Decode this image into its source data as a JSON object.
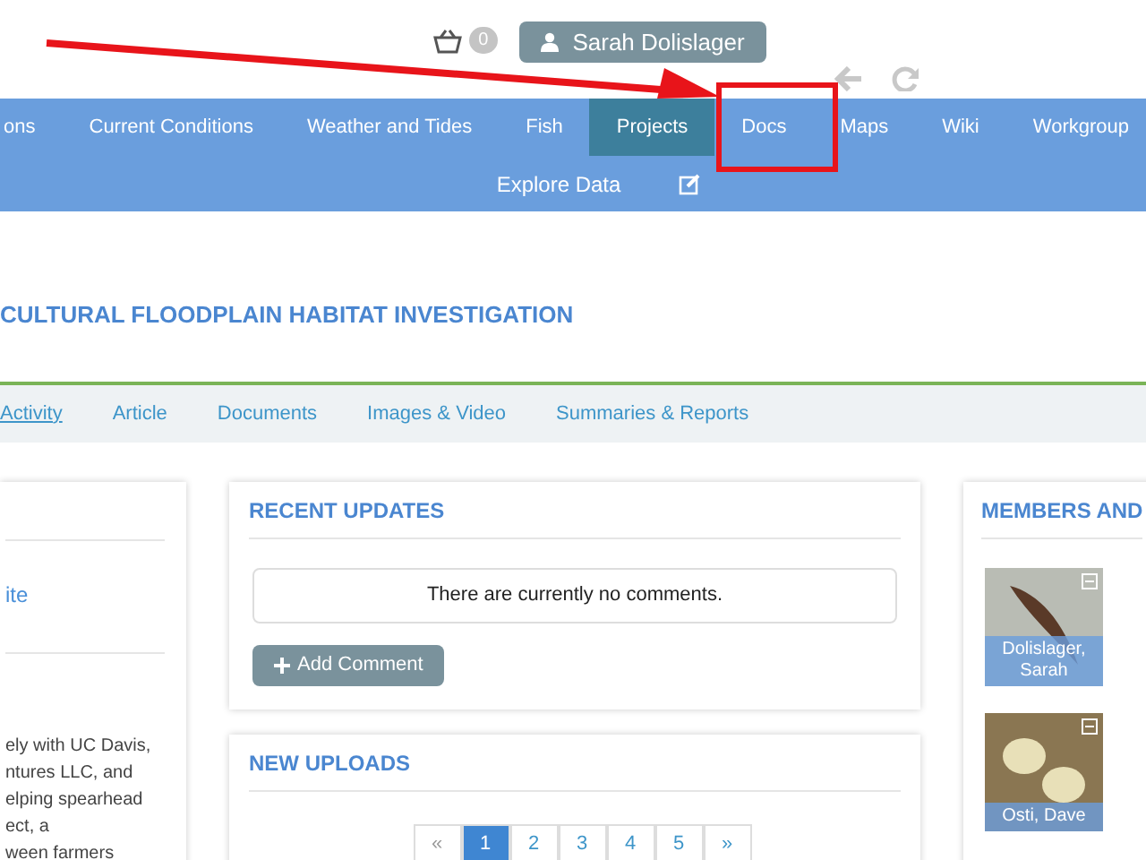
{
  "header": {
    "cart_count": "0",
    "user": "Sarah Dolislager"
  },
  "nav": {
    "items": [
      {
        "label": "ons",
        "selected": false
      },
      {
        "label": "Current Conditions",
        "selected": false
      },
      {
        "label": "Weather and Tides",
        "selected": false
      },
      {
        "label": "Fish",
        "selected": false
      },
      {
        "label": "Projects",
        "selected": true
      },
      {
        "label": "Docs",
        "selected": false
      },
      {
        "label": "Maps",
        "selected": false
      },
      {
        "label": "Wiki",
        "selected": false
      },
      {
        "label": "Workgroup",
        "selected": false
      }
    ],
    "second_row": "Explore Data"
  },
  "title": "CULTURAL FLOODPLAIN HABITAT INVESTIGATION",
  "tabs": [
    {
      "label": "Activity",
      "selected": true
    },
    {
      "label": "Article",
      "selected": false
    },
    {
      "label": "Documents",
      "selected": false
    },
    {
      "label": "Images & Video",
      "selected": false
    },
    {
      "label": "Summaries & Reports",
      "selected": false
    }
  ],
  "left_card": {
    "link": "ite",
    "text": "ely with UC Davis,\nntures LLC, and\nelping spearhead\nect, a\nween farmers"
  },
  "recent_updates": {
    "title": "RECENT UPDATES",
    "empty": "There are currently no comments.",
    "button": "Add Comment"
  },
  "new_uploads": {
    "title": "NEW UPLOADS",
    "pages": [
      {
        "label": "«",
        "selected": false,
        "disabled": true
      },
      {
        "label": "1",
        "selected": true,
        "disabled": false
      },
      {
        "label": "2",
        "selected": false,
        "disabled": false
      },
      {
        "label": "3",
        "selected": false,
        "disabled": false
      },
      {
        "label": "4",
        "selected": false,
        "disabled": false
      },
      {
        "label": "5",
        "selected": false,
        "disabled": false
      },
      {
        "label": "»",
        "selected": false,
        "disabled": false
      }
    ]
  },
  "members": {
    "title": "MEMBERS AND",
    "items": [
      {
        "name": "Dolislager, Sarah"
      },
      {
        "name": "Osti, Dave"
      }
    ]
  }
}
